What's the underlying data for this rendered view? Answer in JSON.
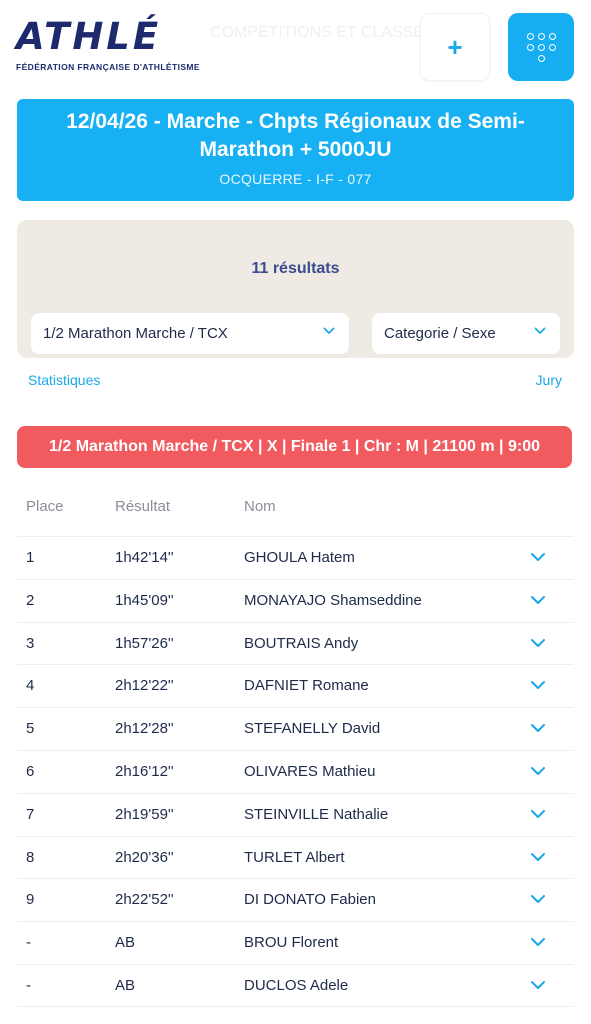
{
  "header": {
    "logo_text": "ATHLÉ",
    "logo_subtitle": "FÉDÉRATION FRANÇAISE D'ATHLÉTISME",
    "ghost_text": "COMPÉTITIONS ET CLASSEMENTS",
    "plus_label": "+",
    "menu_icon": "grid-dots-icon"
  },
  "event": {
    "title": "12/04/26 - Marche - Chpts Régionaux de Semi-Marathon + 5000JU",
    "subtitle": "OCQUERRE - I-F - 077"
  },
  "filters": {
    "result_count": "11 résultats",
    "event_select": "1/2 Marathon Marche / TCX",
    "category_select": "Categorie / Sexe"
  },
  "links": {
    "statistics": "Statistiques",
    "jury": "Jury"
  },
  "race": {
    "label": "1/2 Marathon Marche / TCX | X | Finale 1 | Chr : M | 21100 m | 9:00"
  },
  "table": {
    "headers": {
      "place": "Place",
      "result": "Résultat",
      "name": "Nom"
    },
    "rows": [
      {
        "place": "1",
        "result": "1h42'14''",
        "name": "GHOULA Hatem"
      },
      {
        "place": "2",
        "result": "1h45'09''",
        "name": "MONAYAJO Shamseddine"
      },
      {
        "place": "3",
        "result": "1h57'26''",
        "name": "BOUTRAIS Andy"
      },
      {
        "place": "4",
        "result": "2h12'22''",
        "name": "DAFNIET Romane"
      },
      {
        "place": "5",
        "result": "2h12'28''",
        "name": "STEFANELLY David"
      },
      {
        "place": "6",
        "result": "2h16'12''",
        "name": "OLIVARES Mathieu"
      },
      {
        "place": "7",
        "result": "2h19'59''",
        "name": "STEINVILLE Nathalie"
      },
      {
        "place": "8",
        "result": "2h20'36''",
        "name": "TURLET Albert"
      },
      {
        "place": "9",
        "result": "2h22'52''",
        "name": "DI DONATO Fabien"
      },
      {
        "place": "-",
        "result": "AB",
        "name": "BROU Florent"
      },
      {
        "place": "-",
        "result": "AB",
        "name": "DUCLOS Adele"
      }
    ]
  },
  "colors": {
    "brand_blue": "#16aef0",
    "navy": "#1d2b6e",
    "race_red": "#f15a5f",
    "filter_bg": "#efeae4",
    "link_blue": "#1aa8e8"
  }
}
